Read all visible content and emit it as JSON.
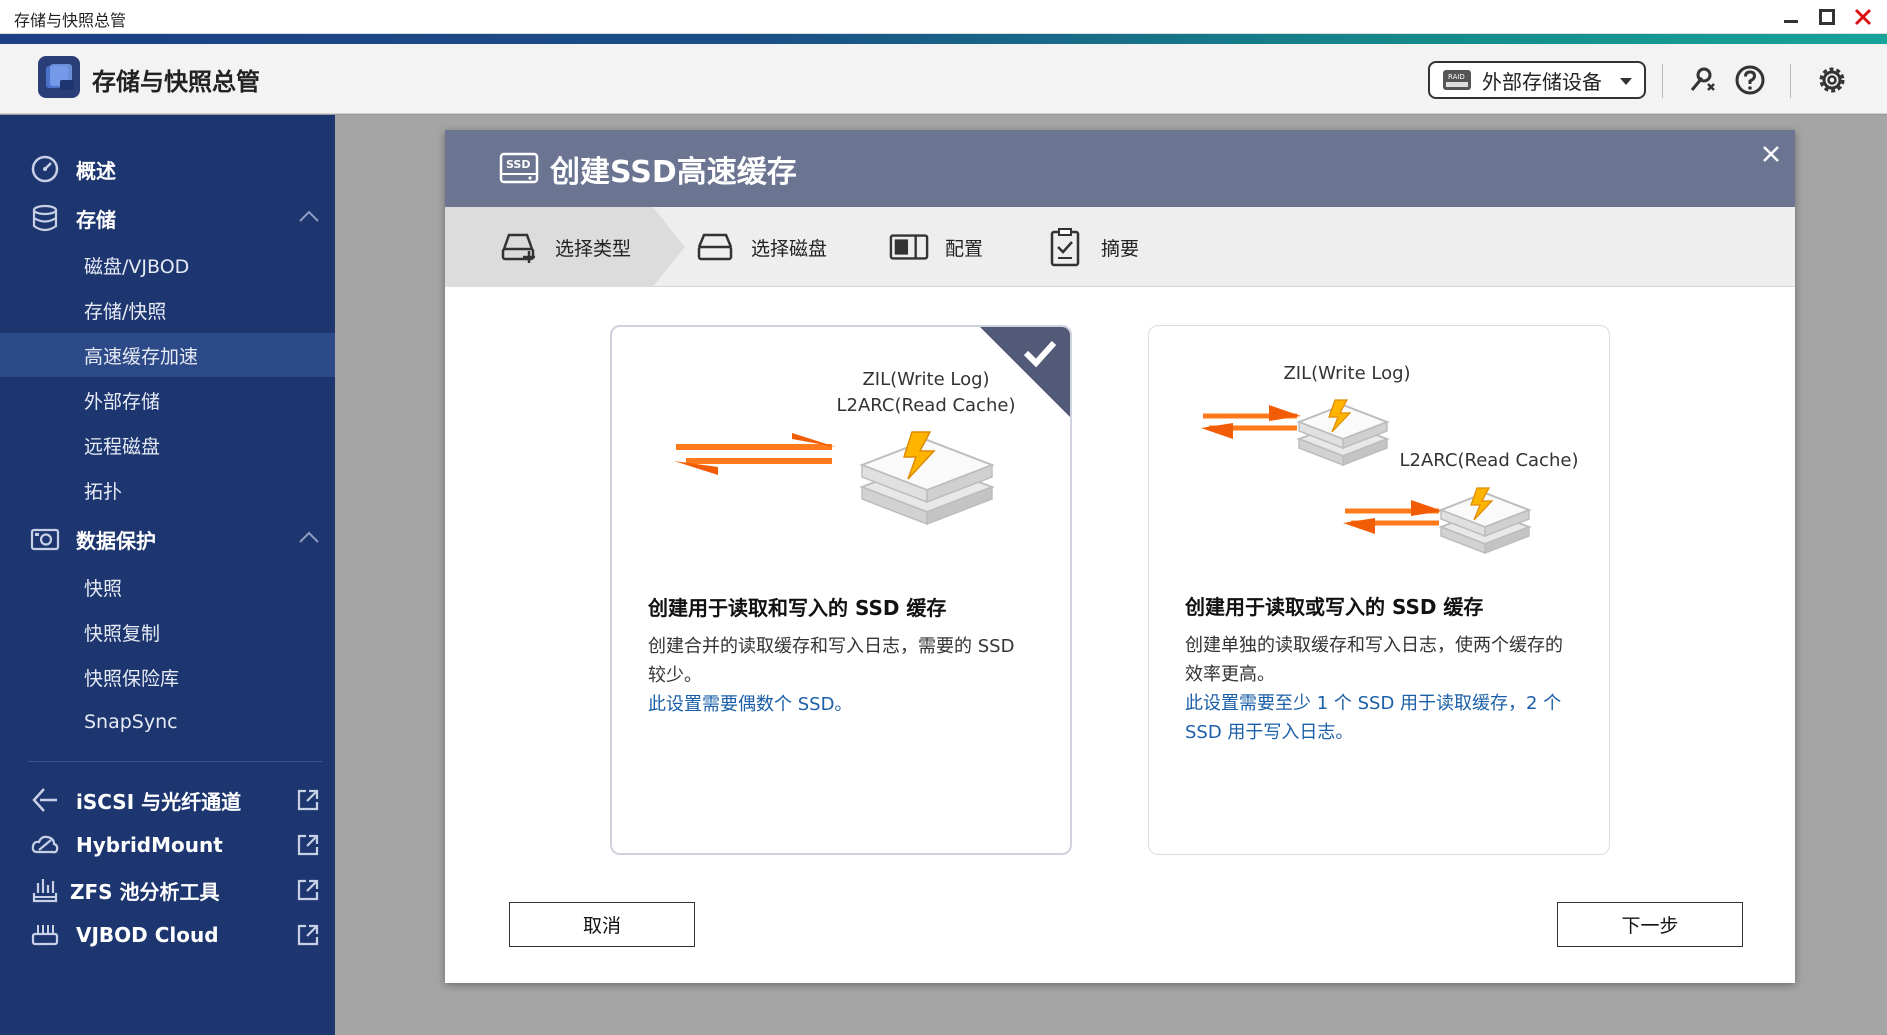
{
  "window": {
    "title": "存储与快照总管"
  },
  "header": {
    "app_title": "存储与快照总管",
    "external_storage_label": "外部存储设备",
    "raid_tag": "RAID"
  },
  "sidebar": {
    "overview": "概述",
    "storage": "存储",
    "storage_items": [
      "磁盘/VJBOD",
      "存储/快照",
      "高速缓存加速",
      "外部存储",
      "远程磁盘",
      "拓扑"
    ],
    "data_protection": "数据保护",
    "protection_items": [
      "快照",
      "快照复制",
      "快照保险库",
      "SnapSync"
    ],
    "iscsi": "iSCSI 与光纤通道",
    "hybridmount": "HybridMount",
    "zfs": "ZFS 池分析工具",
    "vjbod_cloud": "VJBOD Cloud",
    "active_item": "高速缓存加速"
  },
  "dialog": {
    "ssd_tag": "SSD",
    "title": "创建SSD高速缓存",
    "steps": [
      "选择类型",
      "选择磁盘",
      "配置",
      "摘要"
    ],
    "cards": [
      {
        "zil_label": "ZIL(Write Log)",
        "l2arc_label": "L2ARC(Read Cache)",
        "title": "创建用于读取和写入的 SSD 缓存",
        "desc": "创建合并的读取缓存和写入日志，需要的 SSD 较少。",
        "note": "此设置需要偶数个 SSD。",
        "selected": true
      },
      {
        "zil_label": "ZIL(Write Log)",
        "l2arc_label": "L2ARC(Read Cache)",
        "title": "创建用于读取或写入的 SSD 缓存",
        "desc": "创建单独的读取缓存和写入日志，使两个缓存的效率更高。",
        "note": "此设置需要至少 1 个 SSD 用于读取缓存，2 个 SSD 用于写入日志。",
        "selected": false
      }
    ],
    "cancel": "取消",
    "next": "下一步"
  },
  "colors": {
    "sidebar_bg": "#1d3670",
    "dialog_header": "#6b7490",
    "link_blue": "#1b5fa8",
    "selected_corner": "#535a78"
  }
}
